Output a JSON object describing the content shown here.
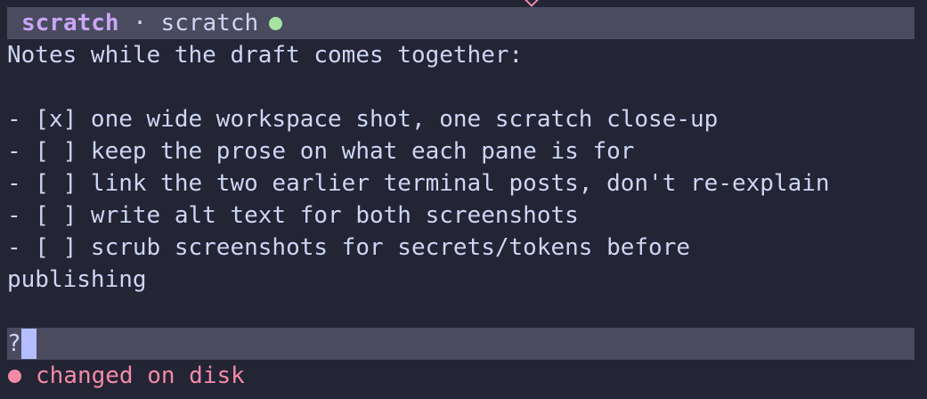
{
  "header": {
    "buffer_name": "scratch",
    "separator": " · ",
    "project_name": "scratch",
    "status_icon": "circle-dot-icon",
    "status_color": "#a6e3a1"
  },
  "editor": {
    "lines": [
      "Notes while the draft comes together:",
      "",
      "- [x] one wide workspace shot, one scratch close-up",
      "- [ ] keep the prose on what each pane is for",
      "- [ ] link the two earlier terminal posts, don't re-explain",
      "- [ ] write alt text for both screenshots",
      "- [ ] scrub screenshots for secrets/tokens before",
      "publishing",
      ""
    ]
  },
  "command_bar": {
    "prompt": "?",
    "value": ""
  },
  "status": {
    "icon": "warning-dot-icon",
    "message": "changed on disk",
    "color": "#f38ba8"
  }
}
